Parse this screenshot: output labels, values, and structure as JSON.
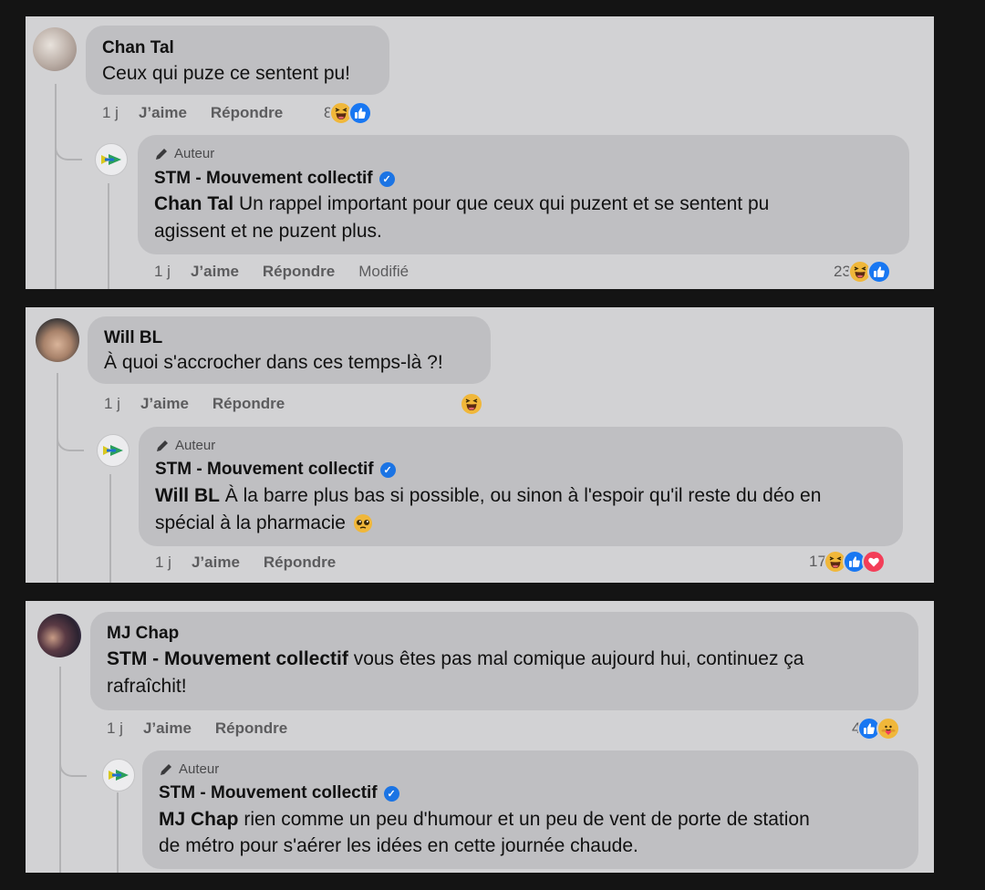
{
  "threads": [
    {
      "comment": {
        "author": "Chan Tal",
        "text": "Ceux qui puze ce sentent pu!",
        "time": "1 j",
        "like_label": "J’aime",
        "reply_label": "Répondre",
        "reaction_count": "8",
        "reactions": [
          "haha",
          "like"
        ]
      },
      "reply": {
        "author_badge": "Auteur",
        "page_name": "STM - Mouvement collectif",
        "mention": "Chan Tal",
        "text_line1": " Un rappel important pour que ceux qui puzent et se sentent pu",
        "text_line2": "agissent et ne puzent plus.",
        "time": "1 j",
        "like_label": "J’aime",
        "reply_label": "Répondre",
        "modified_label": "Modifié",
        "reaction_count": "23",
        "reactions": [
          "haha",
          "like"
        ]
      }
    },
    {
      "comment": {
        "author": "Will BL",
        "text": "À quoi s'accrocher dans ces temps-là ?!",
        "time": "1 j",
        "like_label": "J’aime",
        "reply_label": "Répondre",
        "reaction_count": "",
        "reactions": [
          "haha"
        ]
      },
      "reply": {
        "author_badge": "Auteur",
        "page_name": "STM - Mouvement collectif",
        "mention": "Will BL",
        "text_line1": " À la barre plus bas si possible, ou sinon à l'espoir qu'il reste du déo en",
        "text_line2": "spécial à la pharmacie",
        "text_emoji": "pleading-face",
        "time": "1 j",
        "like_label": "J’aime",
        "reply_label": "Répondre",
        "reaction_count": "17",
        "reactions": [
          "haha",
          "like",
          "love"
        ]
      }
    },
    {
      "comment": {
        "author": "MJ Chap",
        "mention": "STM - Mouvement collectif",
        "text_line1": " vous êtes pas mal comique aujourd hui, continuez ça",
        "text_line2": "rafraîchit!",
        "time": "1 j",
        "like_label": "J’aime",
        "reply_label": "Répondre",
        "reaction_count": "4",
        "reactions": [
          "like",
          "care"
        ]
      },
      "reply": {
        "author_badge": "Auteur",
        "page_name": "STM - Mouvement collectif",
        "mention": "MJ Chap",
        "text_line1": " rien comme un peu d'humour et un peu de vent de porte de station",
        "text_line2": "de métro pour s'aérer les idées en cette journée chaude."
      }
    }
  ],
  "colors": {
    "background": "#141414",
    "panel": "#d2d2d4",
    "bubble": "#bfbfc2",
    "like_blue": "#1877f2",
    "haha_yellow": "#f0b73a",
    "love_red": "#f33e58",
    "verified_blue": "#1b74e4"
  }
}
